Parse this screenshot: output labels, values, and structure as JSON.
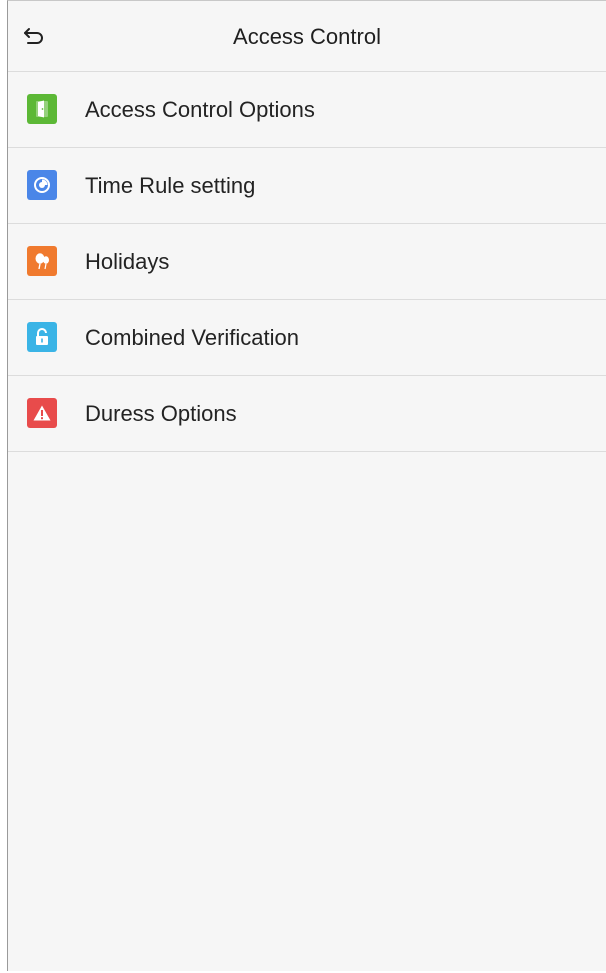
{
  "header": {
    "title": "Access Control",
    "back_icon": "back-arrow-icon"
  },
  "menu": {
    "items": [
      {
        "label": "Access Control Options",
        "icon": "door-icon",
        "color": "#5cb836"
      },
      {
        "label": "Time Rule setting",
        "icon": "clock-icon",
        "color": "#4a86e8"
      },
      {
        "label": "Holidays",
        "icon": "balloons-icon",
        "color": "#f07a2e"
      },
      {
        "label": "Combined Verification",
        "icon": "lock-icon",
        "color": "#3ab4e6"
      },
      {
        "label": "Duress Options",
        "icon": "warning-icon",
        "color": "#e84b4b"
      }
    ]
  }
}
